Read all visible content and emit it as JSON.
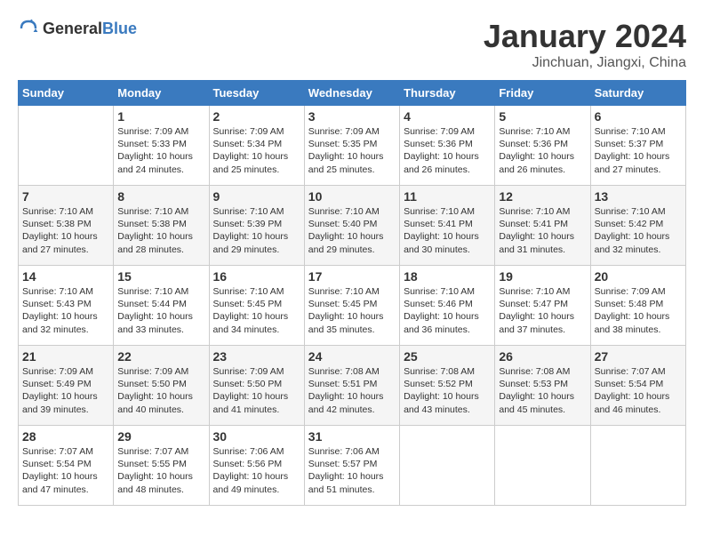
{
  "header": {
    "logo_general": "General",
    "logo_blue": "Blue",
    "month_title": "January 2024",
    "location": "Jinchuan, Jiangxi, China"
  },
  "weekdays": [
    "Sunday",
    "Monday",
    "Tuesday",
    "Wednesday",
    "Thursday",
    "Friday",
    "Saturday"
  ],
  "weeks": [
    [
      {
        "day": "",
        "empty": true
      },
      {
        "day": "1",
        "sunrise": "Sunrise: 7:09 AM",
        "sunset": "Sunset: 5:33 PM",
        "daylight": "Daylight: 10 hours and 24 minutes."
      },
      {
        "day": "2",
        "sunrise": "Sunrise: 7:09 AM",
        "sunset": "Sunset: 5:34 PM",
        "daylight": "Daylight: 10 hours and 25 minutes."
      },
      {
        "day": "3",
        "sunrise": "Sunrise: 7:09 AM",
        "sunset": "Sunset: 5:35 PM",
        "daylight": "Daylight: 10 hours and 25 minutes."
      },
      {
        "day": "4",
        "sunrise": "Sunrise: 7:09 AM",
        "sunset": "Sunset: 5:36 PM",
        "daylight": "Daylight: 10 hours and 26 minutes."
      },
      {
        "day": "5",
        "sunrise": "Sunrise: 7:10 AM",
        "sunset": "Sunset: 5:36 PM",
        "daylight": "Daylight: 10 hours and 26 minutes."
      },
      {
        "day": "6",
        "sunrise": "Sunrise: 7:10 AM",
        "sunset": "Sunset: 5:37 PM",
        "daylight": "Daylight: 10 hours and 27 minutes."
      }
    ],
    [
      {
        "day": "7",
        "sunrise": "Sunrise: 7:10 AM",
        "sunset": "Sunset: 5:38 PM",
        "daylight": "Daylight: 10 hours and 27 minutes."
      },
      {
        "day": "8",
        "sunrise": "Sunrise: 7:10 AM",
        "sunset": "Sunset: 5:38 PM",
        "daylight": "Daylight: 10 hours and 28 minutes."
      },
      {
        "day": "9",
        "sunrise": "Sunrise: 7:10 AM",
        "sunset": "Sunset: 5:39 PM",
        "daylight": "Daylight: 10 hours and 29 minutes."
      },
      {
        "day": "10",
        "sunrise": "Sunrise: 7:10 AM",
        "sunset": "Sunset: 5:40 PM",
        "daylight": "Daylight: 10 hours and 29 minutes."
      },
      {
        "day": "11",
        "sunrise": "Sunrise: 7:10 AM",
        "sunset": "Sunset: 5:41 PM",
        "daylight": "Daylight: 10 hours and 30 minutes."
      },
      {
        "day": "12",
        "sunrise": "Sunrise: 7:10 AM",
        "sunset": "Sunset: 5:41 PM",
        "daylight": "Daylight: 10 hours and 31 minutes."
      },
      {
        "day": "13",
        "sunrise": "Sunrise: 7:10 AM",
        "sunset": "Sunset: 5:42 PM",
        "daylight": "Daylight: 10 hours and 32 minutes."
      }
    ],
    [
      {
        "day": "14",
        "sunrise": "Sunrise: 7:10 AM",
        "sunset": "Sunset: 5:43 PM",
        "daylight": "Daylight: 10 hours and 32 minutes."
      },
      {
        "day": "15",
        "sunrise": "Sunrise: 7:10 AM",
        "sunset": "Sunset: 5:44 PM",
        "daylight": "Daylight: 10 hours and 33 minutes."
      },
      {
        "day": "16",
        "sunrise": "Sunrise: 7:10 AM",
        "sunset": "Sunset: 5:45 PM",
        "daylight": "Daylight: 10 hours and 34 minutes."
      },
      {
        "day": "17",
        "sunrise": "Sunrise: 7:10 AM",
        "sunset": "Sunset: 5:45 PM",
        "daylight": "Daylight: 10 hours and 35 minutes."
      },
      {
        "day": "18",
        "sunrise": "Sunrise: 7:10 AM",
        "sunset": "Sunset: 5:46 PM",
        "daylight": "Daylight: 10 hours and 36 minutes."
      },
      {
        "day": "19",
        "sunrise": "Sunrise: 7:10 AM",
        "sunset": "Sunset: 5:47 PM",
        "daylight": "Daylight: 10 hours and 37 minutes."
      },
      {
        "day": "20",
        "sunrise": "Sunrise: 7:09 AM",
        "sunset": "Sunset: 5:48 PM",
        "daylight": "Daylight: 10 hours and 38 minutes."
      }
    ],
    [
      {
        "day": "21",
        "sunrise": "Sunrise: 7:09 AM",
        "sunset": "Sunset: 5:49 PM",
        "daylight": "Daylight: 10 hours and 39 minutes."
      },
      {
        "day": "22",
        "sunrise": "Sunrise: 7:09 AM",
        "sunset": "Sunset: 5:50 PM",
        "daylight": "Daylight: 10 hours and 40 minutes."
      },
      {
        "day": "23",
        "sunrise": "Sunrise: 7:09 AM",
        "sunset": "Sunset: 5:50 PM",
        "daylight": "Daylight: 10 hours and 41 minutes."
      },
      {
        "day": "24",
        "sunrise": "Sunrise: 7:08 AM",
        "sunset": "Sunset: 5:51 PM",
        "daylight": "Daylight: 10 hours and 42 minutes."
      },
      {
        "day": "25",
        "sunrise": "Sunrise: 7:08 AM",
        "sunset": "Sunset: 5:52 PM",
        "daylight": "Daylight: 10 hours and 43 minutes."
      },
      {
        "day": "26",
        "sunrise": "Sunrise: 7:08 AM",
        "sunset": "Sunset: 5:53 PM",
        "daylight": "Daylight: 10 hours and 45 minutes."
      },
      {
        "day": "27",
        "sunrise": "Sunrise: 7:07 AM",
        "sunset": "Sunset: 5:54 PM",
        "daylight": "Daylight: 10 hours and 46 minutes."
      }
    ],
    [
      {
        "day": "28",
        "sunrise": "Sunrise: 7:07 AM",
        "sunset": "Sunset: 5:54 PM",
        "daylight": "Daylight: 10 hours and 47 minutes."
      },
      {
        "day": "29",
        "sunrise": "Sunrise: 7:07 AM",
        "sunset": "Sunset: 5:55 PM",
        "daylight": "Daylight: 10 hours and 48 minutes."
      },
      {
        "day": "30",
        "sunrise": "Sunrise: 7:06 AM",
        "sunset": "Sunset: 5:56 PM",
        "daylight": "Daylight: 10 hours and 49 minutes."
      },
      {
        "day": "31",
        "sunrise": "Sunrise: 7:06 AM",
        "sunset": "Sunset: 5:57 PM",
        "daylight": "Daylight: 10 hours and 51 minutes."
      },
      {
        "day": "",
        "empty": true
      },
      {
        "day": "",
        "empty": true
      },
      {
        "day": "",
        "empty": true
      }
    ]
  ]
}
